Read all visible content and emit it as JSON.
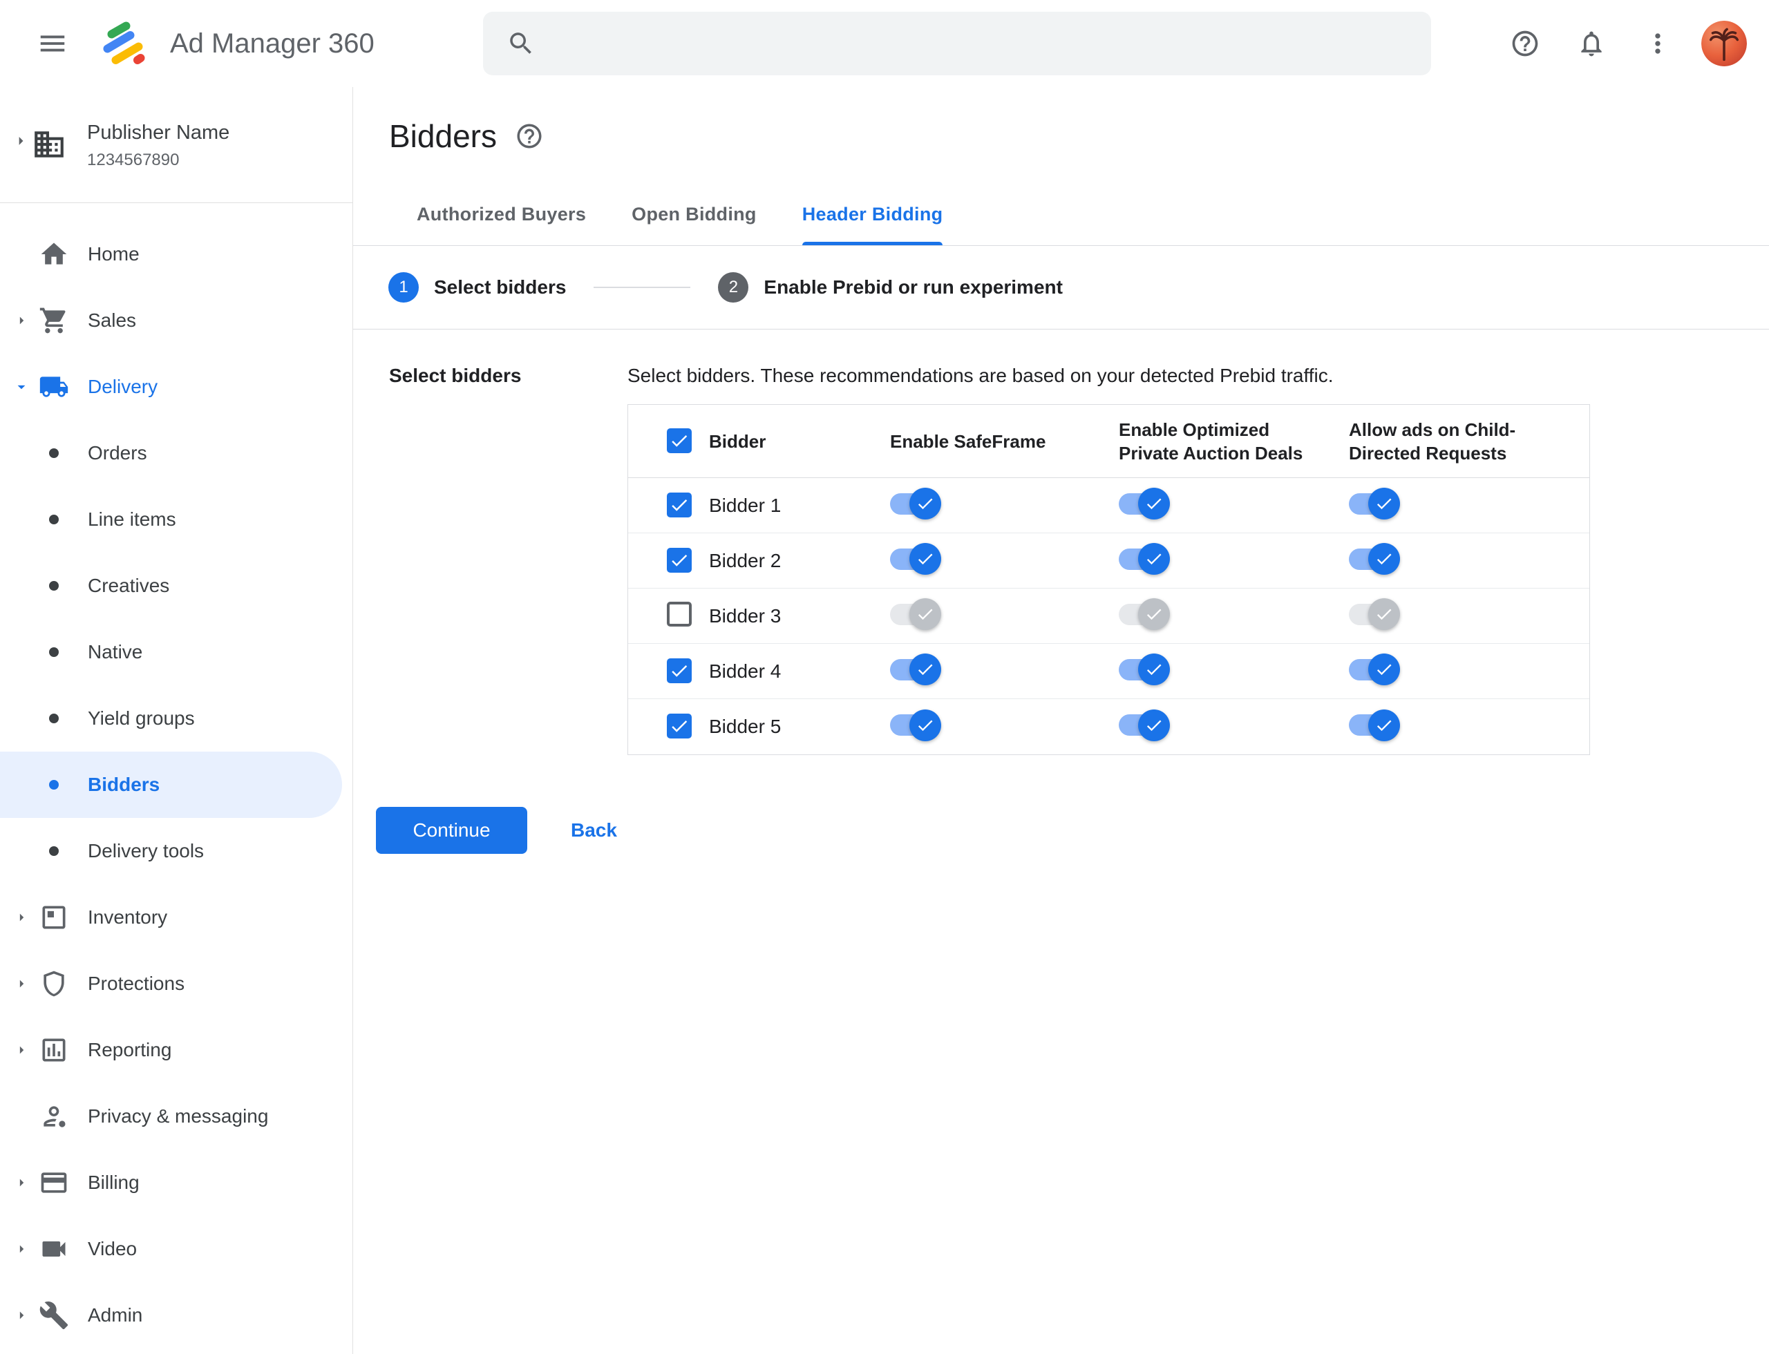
{
  "header": {
    "app_title": "Ad Manager 360",
    "search": {
      "value": "",
      "placeholder": ""
    }
  },
  "sidebar": {
    "publisher_name": "Publisher Name",
    "publisher_id": "1234567890",
    "items": [
      {
        "label": "Home",
        "icon": "home-icon",
        "chevron": "none",
        "level": "top"
      },
      {
        "label": "Sales",
        "icon": "cart-icon",
        "chevron": "right",
        "level": "top"
      },
      {
        "label": "Delivery",
        "icon": "truck-icon",
        "chevron": "down",
        "level": "top",
        "active_section": true
      },
      {
        "label": "Orders",
        "icon": "bullet",
        "chevron": "none",
        "level": "sub"
      },
      {
        "label": "Line items",
        "icon": "bullet",
        "chevron": "none",
        "level": "sub"
      },
      {
        "label": "Creatives",
        "icon": "bullet",
        "chevron": "none",
        "level": "sub"
      },
      {
        "label": "Native",
        "icon": "bullet",
        "chevron": "none",
        "level": "sub"
      },
      {
        "label": "Yield groups",
        "icon": "bullet",
        "chevron": "none",
        "level": "sub"
      },
      {
        "label": "Bidders",
        "icon": "bullet",
        "chevron": "none",
        "level": "sub",
        "selected": true
      },
      {
        "label": "Delivery tools",
        "icon": "bullet",
        "chevron": "none",
        "level": "sub"
      },
      {
        "label": "Inventory",
        "icon": "inventory-icon",
        "chevron": "right",
        "level": "top"
      },
      {
        "label": "Protections",
        "icon": "shield-icon",
        "chevron": "right",
        "level": "top"
      },
      {
        "label": "Reporting",
        "icon": "report-icon",
        "chevron": "right",
        "level": "top"
      },
      {
        "label": "Privacy & messaging",
        "icon": "privacy-icon",
        "chevron": "none",
        "level": "top"
      },
      {
        "label": "Billing",
        "icon": "billing-icon",
        "chevron": "right",
        "level": "top"
      },
      {
        "label": "Video",
        "icon": "video-icon",
        "chevron": "right",
        "level": "top"
      },
      {
        "label": "Admin",
        "icon": "admin-icon",
        "chevron": "right",
        "level": "top"
      }
    ]
  },
  "main": {
    "page_title": "Bidders",
    "tabs": [
      {
        "label": "Authorized Buyers",
        "active": false
      },
      {
        "label": "Open Bidding",
        "active": false
      },
      {
        "label": "Header Bidding",
        "active": true
      }
    ],
    "stepper": [
      {
        "number": "1",
        "label": "Select bidders",
        "state": "active"
      },
      {
        "number": "2",
        "label": "Enable Prebid or run experiment",
        "state": "upcoming"
      }
    ],
    "section_label": "Select bidders",
    "description": "Select bidders. These recommendations are based on your detected Prebid traffic.",
    "table": {
      "select_all_checked": true,
      "columns": [
        "Bidder",
        "Enable SafeFrame",
        "Enable Optimized Private Auction Deals",
        "Allow ads on Child-Directed Requests"
      ],
      "rows": [
        {
          "name": "Bidder 1",
          "checked": true,
          "enable_safeframe": true,
          "enable_optimized_private_auction_deals": true,
          "allow_ads_child_directed": true
        },
        {
          "name": "Bidder 2",
          "checked": true,
          "enable_safeframe": true,
          "enable_optimized_private_auction_deals": true,
          "allow_ads_child_directed": true
        },
        {
          "name": "Bidder 3",
          "checked": false,
          "enable_safeframe": false,
          "enable_optimized_private_auction_deals": false,
          "allow_ads_child_directed": false
        },
        {
          "name": "Bidder 4",
          "checked": true,
          "enable_safeframe": true,
          "enable_optimized_private_auction_deals": true,
          "allow_ads_child_directed": true
        },
        {
          "name": "Bidder 5",
          "checked": true,
          "enable_safeframe": true,
          "enable_optimized_private_auction_deals": true,
          "allow_ads_child_directed": true
        }
      ]
    },
    "actions": {
      "continue_label": "Continue",
      "back_label": "Back"
    }
  },
  "colors": {
    "primary_blue": "#1a73e8",
    "selected_item_bg": "#e8f0fe",
    "text_dark": "#202124",
    "text_gray": "#5f6368",
    "border": "#dadce0",
    "toggle_on_track": "#8ab4f8",
    "toggle_off_track": "#e6e8eb",
    "toggle_off_thumb": "#bdc1c6"
  }
}
